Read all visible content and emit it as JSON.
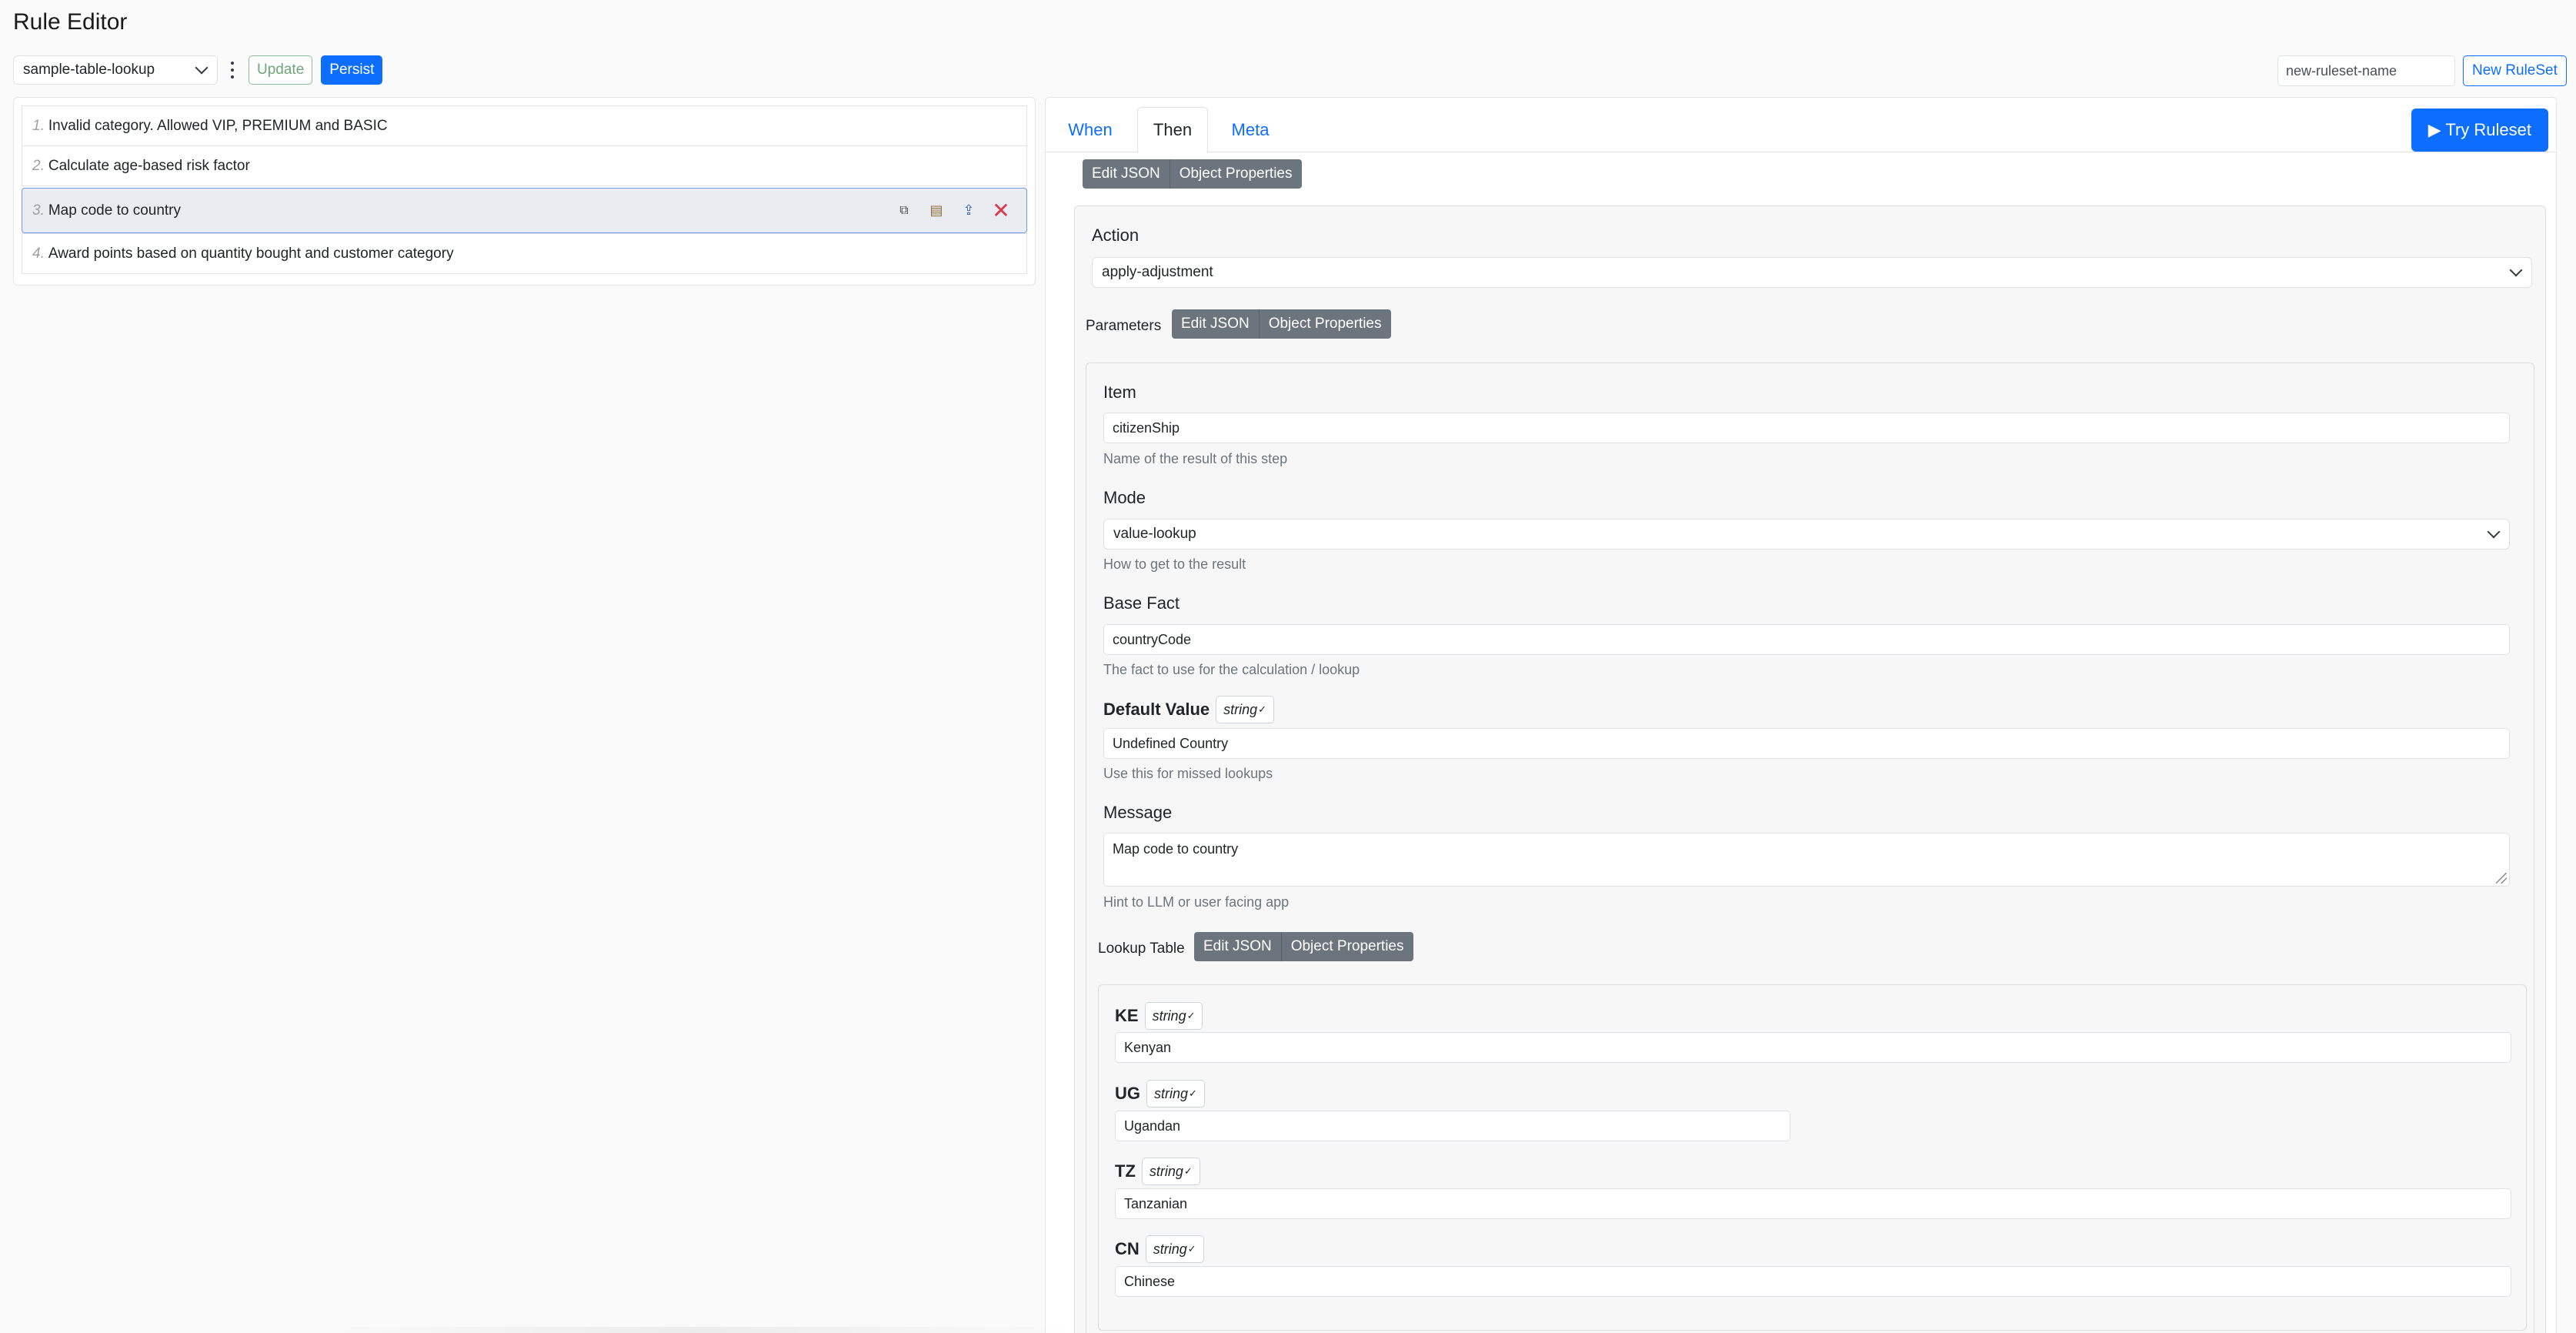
{
  "app": {
    "title": "Rule Editor"
  },
  "toolbar": {
    "ruleset_selected": "sample-table-lookup",
    "update_label": "Update",
    "persist_label": "Persist",
    "new_ruleset_placeholder": "new-ruleset-name",
    "new_ruleset_label": "New RuleSet"
  },
  "rules": [
    {
      "num": "1.",
      "label": "Invalid category. Allowed VIP, PREMIUM and BASIC"
    },
    {
      "num": "2.",
      "label": "Calculate age-based risk factor"
    },
    {
      "num": "3.",
      "label": "Map code to country"
    },
    {
      "num": "4.",
      "label": "Award points based on quantity bought and customer category"
    }
  ],
  "rule_action_icons": [
    "copy-icon",
    "list-icon",
    "upload-icon",
    "close-icon"
  ],
  "tabs": [
    {
      "label": "When"
    },
    {
      "label": "Then"
    },
    {
      "label": "Meta"
    }
  ],
  "try_label": "▶ Try Ruleset",
  "editor": {
    "edit_json": "Edit JSON",
    "object_properties": "Object Properties",
    "action_label": "Action",
    "action_value": "apply-adjustment",
    "parameters_label": "Parameters",
    "item_label": "Item",
    "item_value": "citizenShip",
    "item_help": "Name of the result of this step",
    "mode_label": "Mode",
    "mode_value": "value-lookup",
    "mode_help": "How to get to the result",
    "base_fact_label": "Base Fact",
    "base_fact_value": "countryCode",
    "base_fact_help": "The fact to use for the calculation / lookup",
    "default_value_label": "Default Value",
    "default_value_value": "Undefined Country",
    "default_value_help": "Use this for missed lookups",
    "message_label": "Message",
    "message_value": "Map code to country",
    "message_help": "Hint to LLM or user facing app",
    "lookup_table_label": "Lookup Table",
    "type_string": "string",
    "type_check": "✓",
    "lookup": [
      {
        "key": "KE",
        "value": "Kenyan"
      },
      {
        "key": "UG",
        "value": "Ugandan"
      },
      {
        "key": "TZ",
        "value": "Tanzanian"
      },
      {
        "key": "CN",
        "value": "Chinese"
      }
    ]
  },
  "colors": {
    "primary": "#0d6efd",
    "secondary": "#6c757d",
    "danger": "#dc3545",
    "success": "#6ca67a"
  }
}
